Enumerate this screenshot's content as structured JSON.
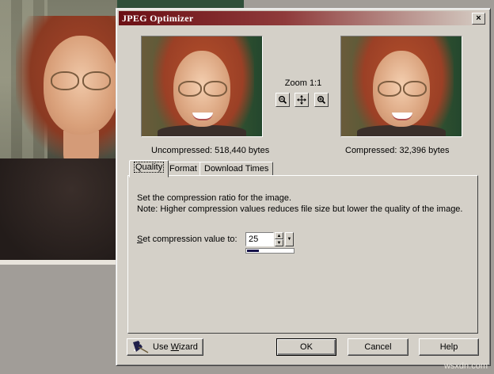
{
  "dialog": {
    "title": "JPEG Optimizer",
    "close_label": "×"
  },
  "preview": {
    "zoom_label": "Zoom 1:1",
    "zoom_out_icon": "zoom-out-icon",
    "pan_icon": "pan-icon",
    "zoom_in_icon": "zoom-in-icon",
    "uncompressed_text": "Uncompressed:  518,440 bytes",
    "compressed_text": "Compressed: 32,396 bytes"
  },
  "tabs": [
    {
      "label": "Quality",
      "active": true
    },
    {
      "label": "Format",
      "active": false
    },
    {
      "label": "Download Times",
      "active": false
    }
  ],
  "quality": {
    "desc_line1": "Set the compression ratio for the image.",
    "desc_line2": "Note:  Higher compression values reduces file size but lower the quality of the image.",
    "compression_label_prefix": "S",
    "compression_label_rest": "et compression value to:",
    "compression_value": "25",
    "compression_fraction": 0.25
  },
  "buttons": {
    "wizard_prefix": "Use ",
    "wizard_underlined": "W",
    "wizard_rest": "izard",
    "ok": "OK",
    "cancel": "Cancel",
    "help": "Help"
  },
  "watermark": "wsxdn.com",
  "colors": {
    "titlebar_start": "#6b0f14",
    "dialog_face": "#d4d0c8",
    "slider_fill": "#16124a"
  }
}
